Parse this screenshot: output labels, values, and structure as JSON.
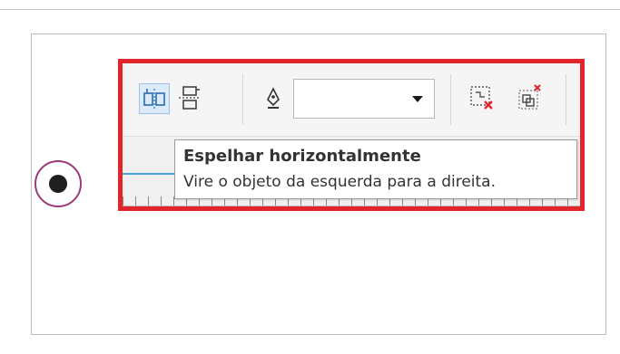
{
  "toolbar": {
    "buttons": [
      {
        "name": "mirror-horizontal-icon",
        "active": true
      },
      {
        "name": "mirror-vertical-icon",
        "active": false
      },
      {
        "name": "outline-pen-icon",
        "active": false
      },
      {
        "name": "clear-envelope-icon",
        "active": false
      },
      {
        "name": "clear-transformations-icon",
        "active": false
      }
    ],
    "outline_dropdown": {
      "value": "",
      "icon": "chevron-down-icon"
    }
  },
  "tooltip": {
    "title": "Espelhar horizontalmente",
    "description": "Vire o objeto da esquerda para a direita."
  },
  "radio": {
    "selected": true
  },
  "colors": {
    "highlight_border": "#e2242b",
    "radio_ring": "#9a3a78",
    "active_button": "#dcebf9",
    "ruler_accent": "#4aa4e0",
    "delete_mark": "#e2242b"
  }
}
